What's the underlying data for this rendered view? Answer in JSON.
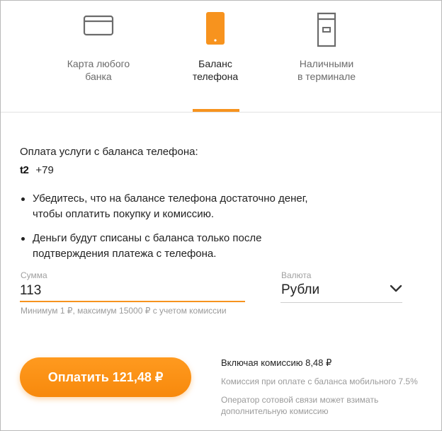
{
  "tabs": [
    {
      "label": "Карта любого\nбанка",
      "icon": "card-icon",
      "active": false
    },
    {
      "label": "Баланс\nтелефона",
      "icon": "phone-icon",
      "active": true
    },
    {
      "label": "Наличными\nв терминале",
      "icon": "terminal-icon",
      "active": false
    }
  ],
  "service": {
    "title": "Оплата услуги с баланса телефона:",
    "operator_logo": "t2",
    "phone": "+79"
  },
  "bullets": [
    "Убедитесь, что на балансе телефона достаточно денег, чтобы оплатить покупку и комиссию.",
    "Деньги будут списаны с баланса только после подтверждения платежа с телефона."
  ],
  "amount": {
    "label": "Сумма",
    "value": "113",
    "hint": "Минимум 1 ₽, максимум 15000 ₽ с учетом комиссии"
  },
  "currency": {
    "label": "Валюта",
    "value": "Рубли"
  },
  "pay_button": {
    "label": "Оплатить 121,48 ₽"
  },
  "commission": {
    "total": "Включая комиссию 8,48 ₽",
    "note": "Комиссия при оплате с баланса мобильного 7.5%",
    "operator_note": "Оператор сотовой связи может взимать дополнительную комиссию"
  },
  "colors": {
    "accent": "#f7931e",
    "icon_gray": "#6b6b6b"
  }
}
